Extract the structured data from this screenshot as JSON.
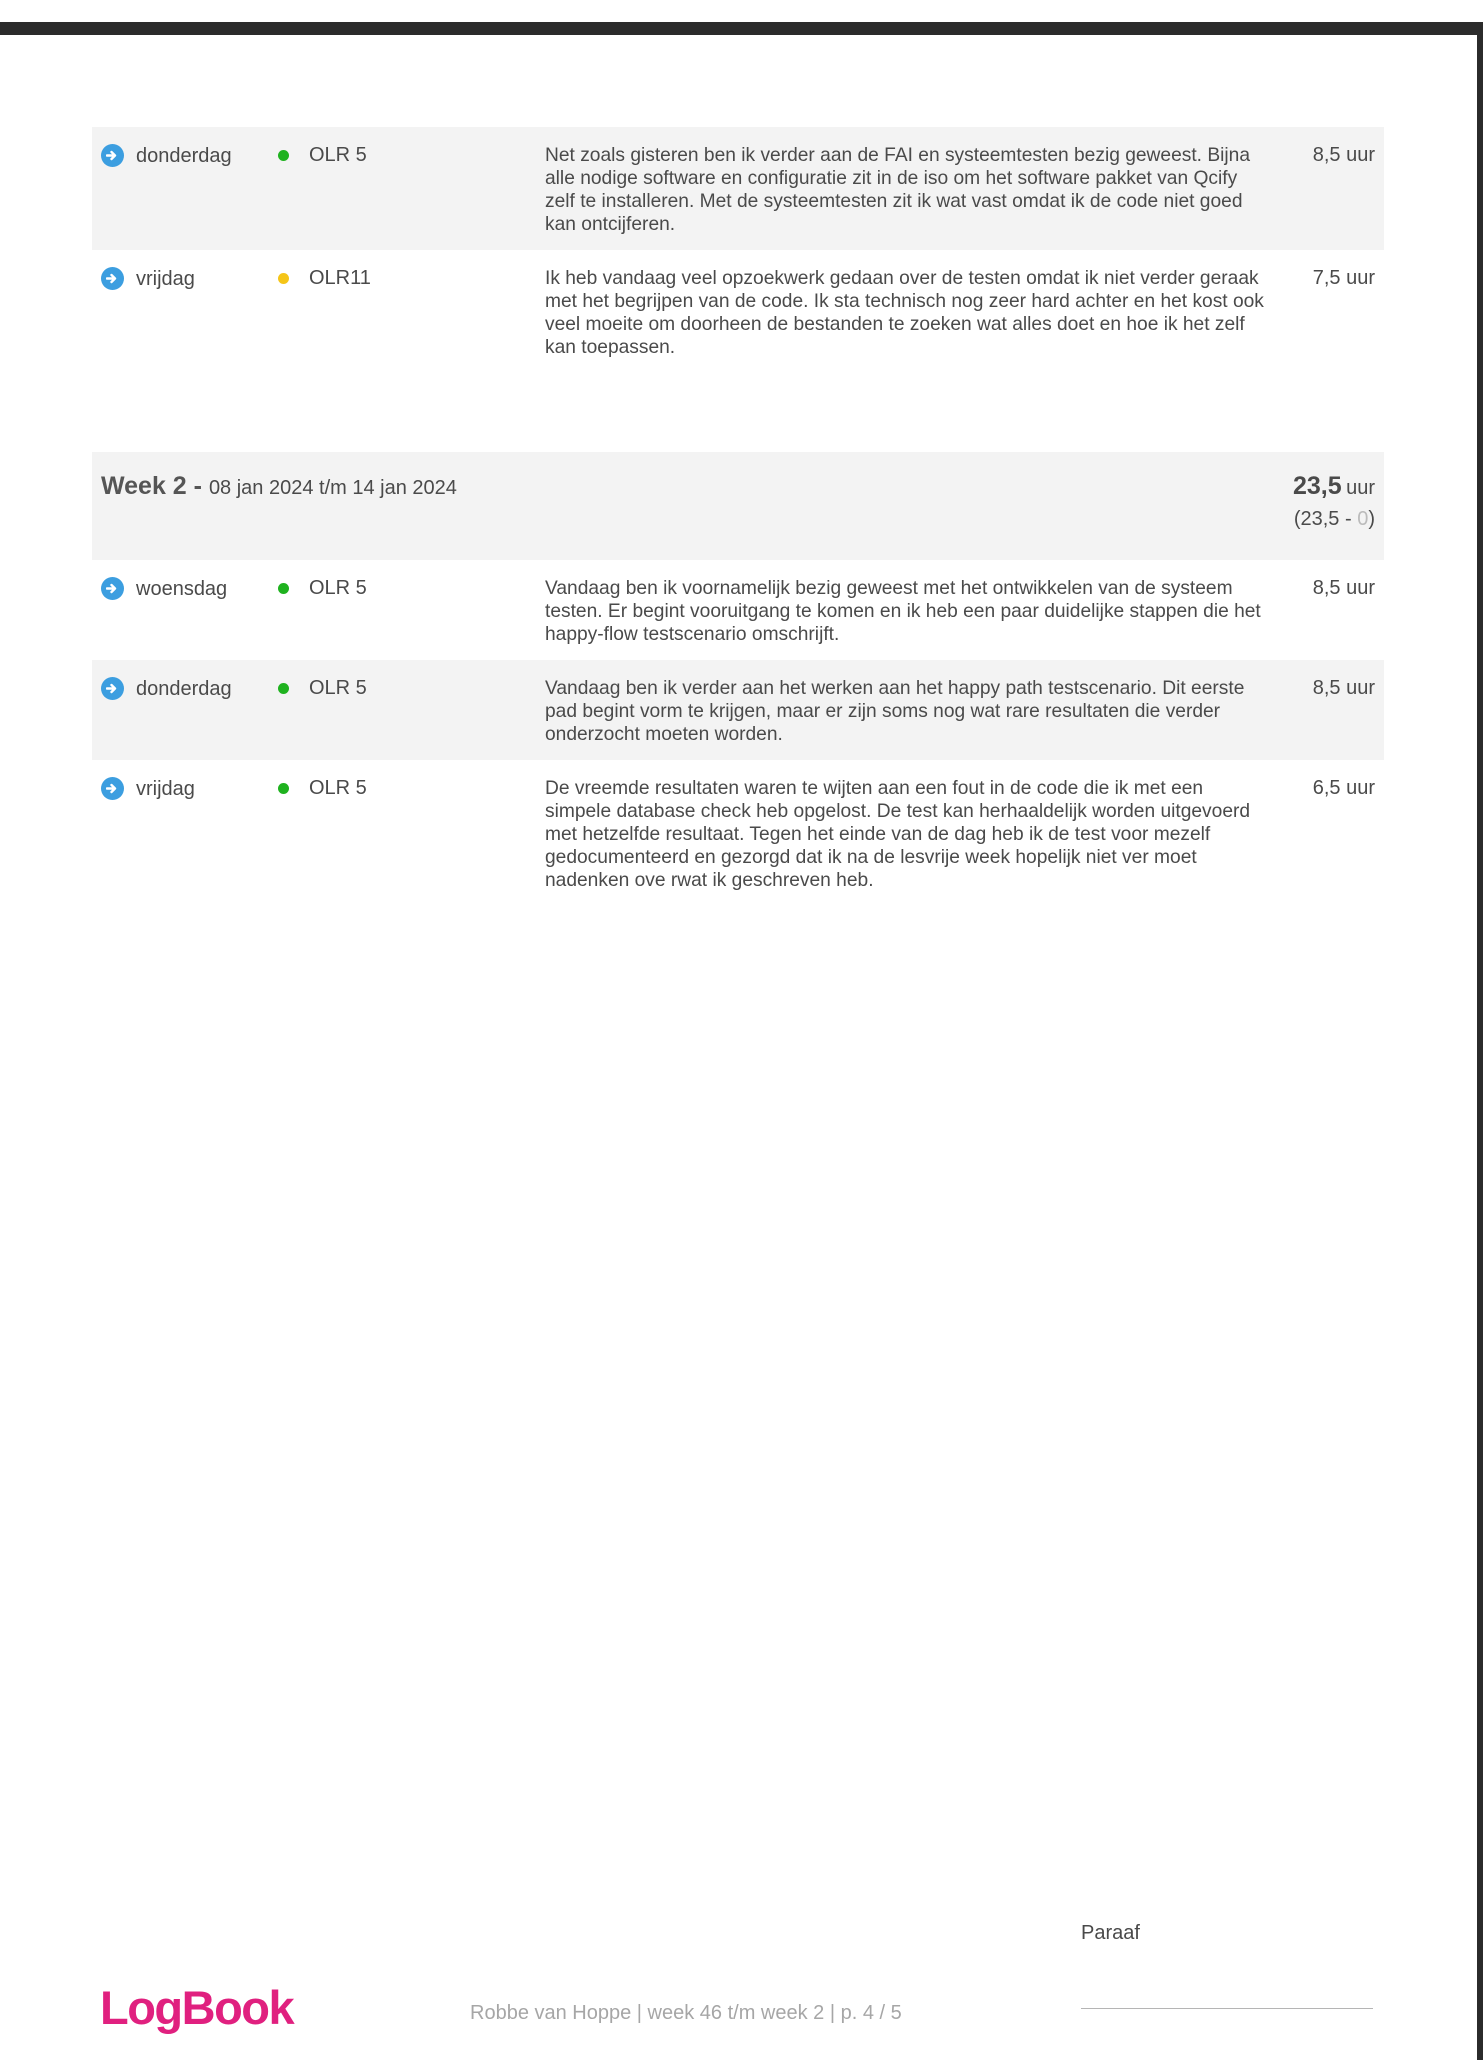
{
  "entries_prev": [
    {
      "day": "donderdag",
      "location": "OLR 5",
      "status_color": "#1fb21f",
      "text": "Net zoals gisteren ben ik verder aan de FAI en systeemtesten bezig geweest. Bijna alle nodige software en configuratie zit in de iso om het software pakket van Qcify zelf te installeren. Met de systeemtesten zit ik wat vast omdat ik de code niet goed kan ontcijferen.",
      "hours": "8,5 uur"
    },
    {
      "day": "vrijdag",
      "location": "OLR11",
      "status_color": "#f5c518",
      "text": "Ik heb vandaag veel opzoekwerk gedaan over de testen omdat ik niet verder geraak met het begrijpen van de code. Ik sta technisch nog zeer hard achter en het kost ook veel moeite om doorheen de bestanden te zoeken wat alles doet en hoe ik het zelf kan toepassen.",
      "hours": "7,5 uur"
    }
  ],
  "week2": {
    "title": "Week 2 -",
    "dates": "08 jan 2024 t/m 14 jan 2024",
    "total": "23,5",
    "unit": "uur",
    "balance_open": "(23,5 - ",
    "balance_zero": "0",
    "balance_close": ")",
    "entries": [
      {
        "day": "woensdag",
        "location": "OLR 5",
        "status_color": "#1fb21f",
        "text": "Vandaag ben ik voornamelijk bezig geweest met het ontwikkelen van de systeem testen. Er begint vooruitgang te komen en ik heb een paar duidelijke stappen die het happy-flow testscenario omschrijft.",
        "hours": "8,5 uur"
      },
      {
        "day": "donderdag",
        "location": "OLR 5",
        "status_color": "#1fb21f",
        "text": "Vandaag ben ik verder aan het werken aan het happy path testscenario. Dit eerste pad begint vorm te krijgen, maar er zijn soms nog wat rare resultaten die verder onderzocht moeten worden.",
        "hours": "8,5 uur"
      },
      {
        "day": "vrijdag",
        "location": "OLR 5",
        "status_color": "#1fb21f",
        "text": "De vreemde resultaten waren te wijten aan een fout in de code die ik met een simpele database check heb opgelost. De test kan herhaaldelijk worden uitgevoerd met hetzelfde resultaat. Tegen het einde van de dag heb ik de test voor mezelf gedocumenteerd en gezorgd dat ik na de lesvrije week hopelijk niet ver moet nadenken ove rwat ik geschreven heb.",
        "hours": "6,5 uur"
      }
    ]
  },
  "footer": {
    "paraaf": "Paraaf",
    "info": "Robbe van Hoppe | week 46 t/m week 2 | p. 4 / 5",
    "logo": "LogBook",
    "sign_line": "________________________"
  },
  "colors": {
    "accent_blue": "#3c9ee0",
    "logo_pink": "#e0207f",
    "status_green": "#1fb21f",
    "status_yellow": "#f5c518"
  },
  "icons": {
    "entry_icon": "arrow-circle-right-icon",
    "status_icon": "status-dot-icon"
  }
}
